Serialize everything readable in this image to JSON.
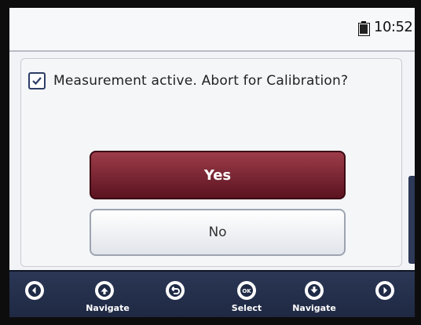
{
  "status": {
    "time": "10:52"
  },
  "dialog": {
    "message": "Measurement active. Abort for Calibration?",
    "yes_label": "Yes",
    "no_label": "No"
  },
  "footer": {
    "keys": [
      {
        "icon": "arrow-left-icon",
        "label": ""
      },
      {
        "icon": "arrow-up-icon",
        "label": "Navigate"
      },
      {
        "icon": "back-icon",
        "label": ""
      },
      {
        "icon": "ok-icon",
        "label": "Select",
        "glyph": "OK"
      },
      {
        "icon": "arrow-down-icon",
        "label": "Navigate"
      },
      {
        "icon": "arrow-right-icon",
        "label": ""
      }
    ]
  },
  "colors": {
    "primary_button": "#6d1d2a",
    "footer_bar": "#25304d"
  }
}
